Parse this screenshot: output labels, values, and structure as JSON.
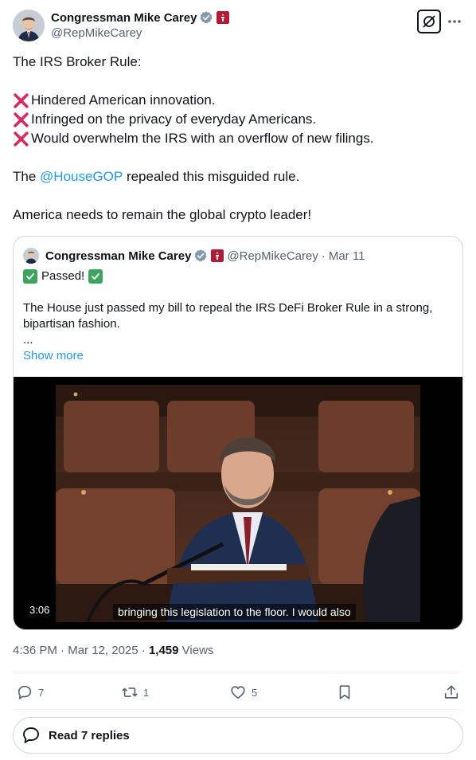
{
  "author": {
    "name": "Congressman Mike Carey",
    "handle": "@RepMikeCarey"
  },
  "tweet": {
    "intro": "The IRS Broker Rule:",
    "points": [
      "Hindered American innovation.",
      "Infringed on the privacy of everyday Americans.",
      "Would overwhelm the IRS with an overflow of new filings."
    ],
    "repeal_prefix": "The ",
    "mention": "@HouseGOP",
    "repeal_suffix": " repealed this misguided rule.",
    "closing": "America needs to remain the global crypto leader!"
  },
  "quote": {
    "name": "Congressman Mike Carey",
    "handle": "@RepMikeCarey",
    "separator": "·",
    "date": "Mar 11",
    "passed": "Passed!",
    "body": "The House just passed my bill to repeal the IRS DeFi Broker Rule in a strong, bipartisan fashion.",
    "ellipsis": "...",
    "show_more": "Show more",
    "video": {
      "duration": "3:06",
      "caption": "bringing this legislation to the floor. I would also"
    }
  },
  "meta": {
    "time": "4:36 PM",
    "separator": "·",
    "date": "Mar 12, 2025",
    "views_count": "1,459",
    "views_label": "Views"
  },
  "actions": {
    "replies": "7",
    "reposts": "1",
    "likes": "5"
  },
  "read_replies": "Read 7 replies",
  "colors": {
    "accent": "#1d9bf0",
    "text": "#0f1419",
    "muted": "#536471",
    "border": "#cfd9de"
  },
  "icons": [
    "verified-badge-icon",
    "congress-flag-icon",
    "grok-icon",
    "more-icon",
    "x-mark-icon",
    "check-mark-icon",
    "reply-icon",
    "repost-icon",
    "like-icon",
    "bookmark-icon",
    "share-icon",
    "read-replies-icon"
  ]
}
